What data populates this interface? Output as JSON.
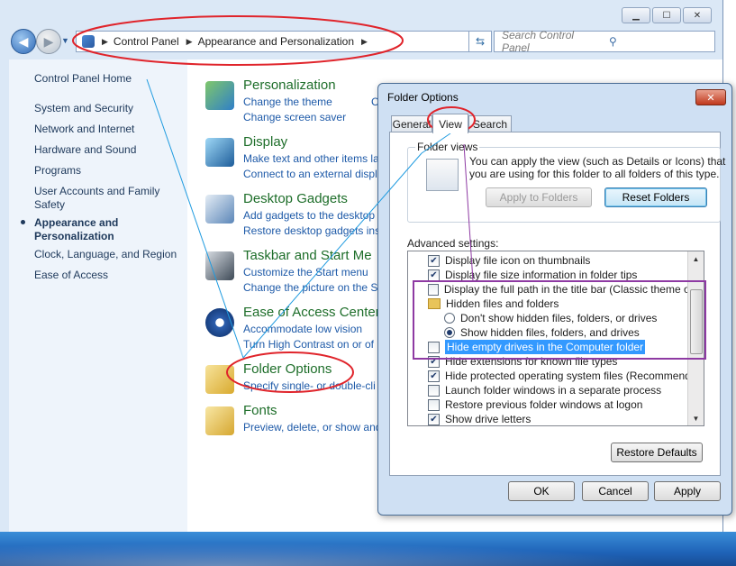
{
  "window": {
    "caption_buttons": [
      "minimize",
      "maximize",
      "close"
    ],
    "breadcrumb": [
      "Control Panel",
      "Appearance and Personalization"
    ],
    "search_placeholder": "Search Control Panel"
  },
  "sidebar": {
    "home": "Control Panel Home",
    "items": [
      {
        "label": "System and Security"
      },
      {
        "label": "Network and Internet"
      },
      {
        "label": "Hardware and Sound"
      },
      {
        "label": "Programs"
      },
      {
        "label": "User Accounts and Family Safety"
      },
      {
        "label": "Appearance and Personalization",
        "current": true
      },
      {
        "label": "Clock, Language, and Region"
      },
      {
        "label": "Ease of Access"
      }
    ]
  },
  "categories": [
    {
      "title": "Personalization",
      "icon": "personalization-icon",
      "links": [
        "Change the theme",
        "Change screen saver"
      ],
      "extra": "Chan"
    },
    {
      "title": "Display",
      "icon": "display-icon",
      "links": [
        "Make text and other items la",
        "Connect to an external displ"
      ]
    },
    {
      "title": "Desktop Gadgets",
      "icon": "gadgets-icon",
      "links": [
        "Add gadgets to the desktop",
        "Restore desktop gadgets inst"
      ]
    },
    {
      "title": "Taskbar and Start Me",
      "icon": "taskbar-icon",
      "links": [
        "Customize the Start menu",
        "Change the picture on the S"
      ]
    },
    {
      "title": "Ease of Access Center",
      "icon": "ease-of-access-icon",
      "links": [
        "Accommodate low vision",
        "Turn High Contrast on or of"
      ]
    },
    {
      "title": "Folder Options",
      "icon": "folder-options-icon",
      "links": [
        "Specify single- or double-cli"
      ]
    },
    {
      "title": "Fonts",
      "icon": "fonts-icon",
      "links": [
        "Preview, delete, or show and"
      ]
    }
  ],
  "dialog": {
    "title": "Folder Options",
    "tabs": [
      "General",
      "View",
      "Search"
    ],
    "active_tab": "View",
    "folder_views": {
      "legend": "Folder views",
      "text_line1": "You can apply the view (such as Details or Icons) that",
      "text_line2": "you are using for this folder to all folders of this type.",
      "apply_button": "Apply to Folders",
      "reset_button": "Reset Folders"
    },
    "advanced_label": "Advanced settings:",
    "settings": [
      {
        "type": "check",
        "checked": true,
        "label": "Display file icon on thumbnails"
      },
      {
        "type": "check",
        "checked": true,
        "label": "Display file size information in folder tips"
      },
      {
        "type": "check",
        "checked": false,
        "label": "Display the full path in the title bar (Classic theme only)"
      },
      {
        "type": "folder",
        "label": "Hidden files and folders"
      },
      {
        "type": "radio",
        "checked": false,
        "label": "Don't show hidden files, folders, or drives"
      },
      {
        "type": "radio",
        "checked": true,
        "label": "Show hidden files, folders, and drives"
      },
      {
        "type": "check",
        "checked": false,
        "label": "Hide empty drives in the Computer folder",
        "selected": true
      },
      {
        "type": "check",
        "checked": true,
        "label": "Hide extensions for known file types"
      },
      {
        "type": "check",
        "checked": true,
        "label": "Hide protected operating system files (Recommended)"
      },
      {
        "type": "check",
        "checked": false,
        "label": "Launch folder windows in a separate process"
      },
      {
        "type": "check",
        "checked": false,
        "label": "Restore previous folder windows at logon"
      },
      {
        "type": "check",
        "checked": true,
        "label": "Show drive letters"
      }
    ],
    "restore_defaults": "Restore Defaults",
    "ok": "OK",
    "cancel": "Cancel",
    "apply": "Apply"
  },
  "annotation_colors": {
    "ellipse": "#e0242b",
    "box": "#8e3aa3",
    "line": "#1f9be0"
  }
}
